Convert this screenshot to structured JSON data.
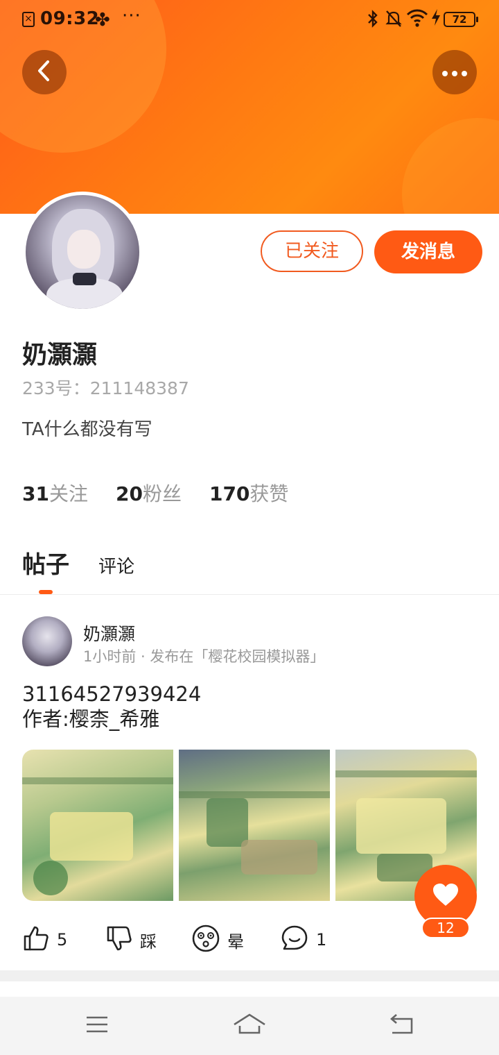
{
  "status_bar": {
    "time": "09:32",
    "battery": "72",
    "overflow": "···"
  },
  "profile": {
    "name": "奶灝灝",
    "id_line": "233号：211148387",
    "bio": "TA什么都没有写",
    "follow_button": "已关注",
    "message_button": "发消息",
    "stats": [
      {
        "num": "31",
        "label": "关注"
      },
      {
        "num": "20",
        "label": "粉丝"
      },
      {
        "num": "170",
        "label": "获赞"
      }
    ]
  },
  "tabs": [
    {
      "label": "帖子",
      "active": true
    },
    {
      "label": "评论",
      "active": false
    }
  ],
  "post": {
    "author": "奶灝灝",
    "meta": "1小时前 · 发布在「樱花校园模拟器」",
    "text_line1": "31164527939424",
    "text_line2": "作者:樱柰_希雅",
    "actions": {
      "like": "5",
      "dislike": "踩",
      "dizzy": "晕",
      "comment": "1"
    },
    "float_like_count": "12"
  },
  "icons": {
    "back": "back-arrow-icon",
    "more": "more-dots-icon",
    "like": "thumbs-up-icon",
    "dislike": "thumbs-down-icon",
    "dizzy": "dizzy-face-icon",
    "comment": "comment-bubble-icon",
    "heart": "heart-icon",
    "nav_menu": "menu-icon",
    "nav_home": "home-icon",
    "nav_back": "back-icon"
  },
  "colors": {
    "accent": "#ff5a14",
    "banner_start": "#ff5a1a",
    "banner_end": "#ff8a10"
  }
}
